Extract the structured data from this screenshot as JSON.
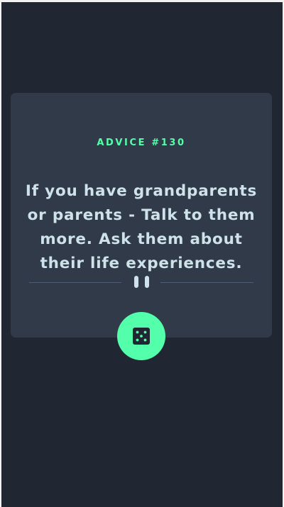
{
  "advice": {
    "id_label": "ADVICE #130",
    "text": "If you have grandparents or parents - Talk to them more. Ask them about their life experiences."
  },
  "icons": {
    "divider": "pause-icon",
    "button": "dice-icon"
  },
  "colors": {
    "background": "#202733",
    "card": "#313a48",
    "accent": "#53ffaa",
    "text": "#cee3e9",
    "divider": "#4f5d74"
  }
}
